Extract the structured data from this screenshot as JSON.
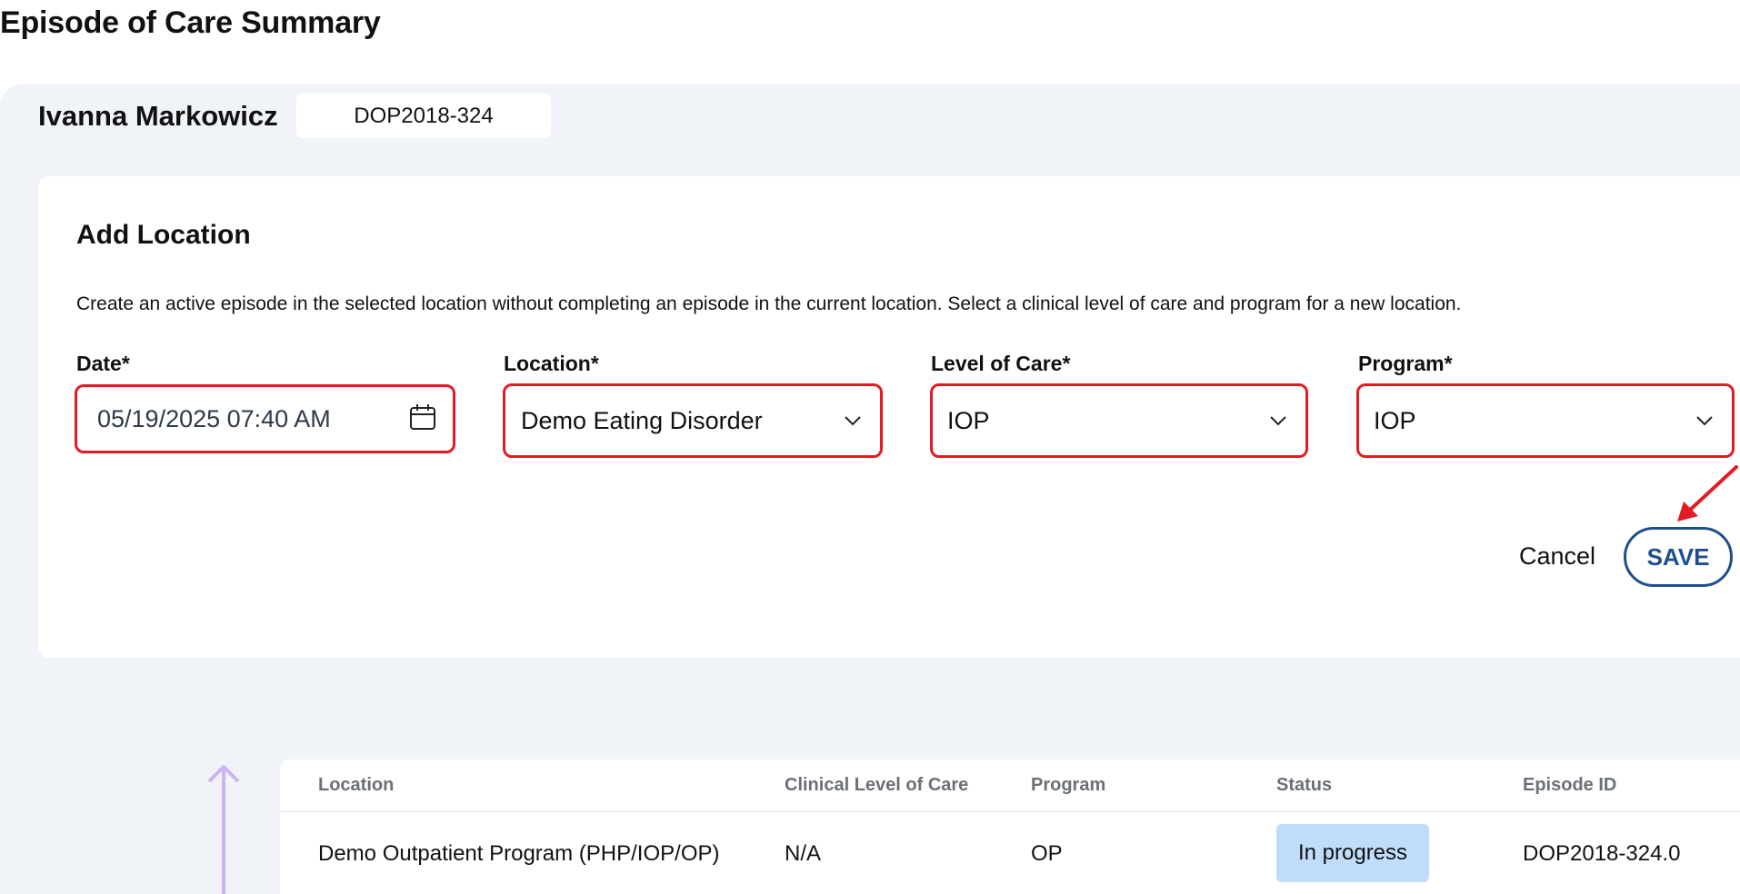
{
  "page": {
    "title": "Episode of Care Summary"
  },
  "patient": {
    "name": "Ivanna Markowicz",
    "episode_id": "DOP2018-324"
  },
  "add_location": {
    "title": "Add Location",
    "description": "Create an active episode in the selected location without completing an episode in the current location. Select a clinical level of care and program for a new location.",
    "fields": {
      "date": {
        "label": "Date*",
        "value": "05/19/2025 07:40 AM",
        "icon": "calendar-icon"
      },
      "location": {
        "label": "Location*",
        "value": "Demo Eating Disorder",
        "icon": "chevron-down-icon"
      },
      "level_of_care": {
        "label": "Level of Care*",
        "value": "IOP",
        "icon": "chevron-down-icon"
      },
      "program": {
        "label": "Program*",
        "value": "IOP",
        "icon": "chevron-down-icon"
      }
    },
    "actions": {
      "cancel": "Cancel",
      "save": "SAVE"
    }
  },
  "annotation": {
    "highlight_color": "#e31b23"
  },
  "colors": {
    "accent": "#1e4e8c",
    "status_badge": "#bfdcfb",
    "panel_bg": "#f0f3f8"
  },
  "episodes_table": {
    "columns": [
      "Location",
      "Clinical Level of Care",
      "Program",
      "Status",
      "Episode ID"
    ],
    "rows": [
      {
        "location": "Demo Outpatient Program (PHP/IOP/OP)",
        "level_of_care": "N/A",
        "program": "OP",
        "status": "In progress",
        "episode_id": "DOP2018-324.0"
      }
    ]
  }
}
